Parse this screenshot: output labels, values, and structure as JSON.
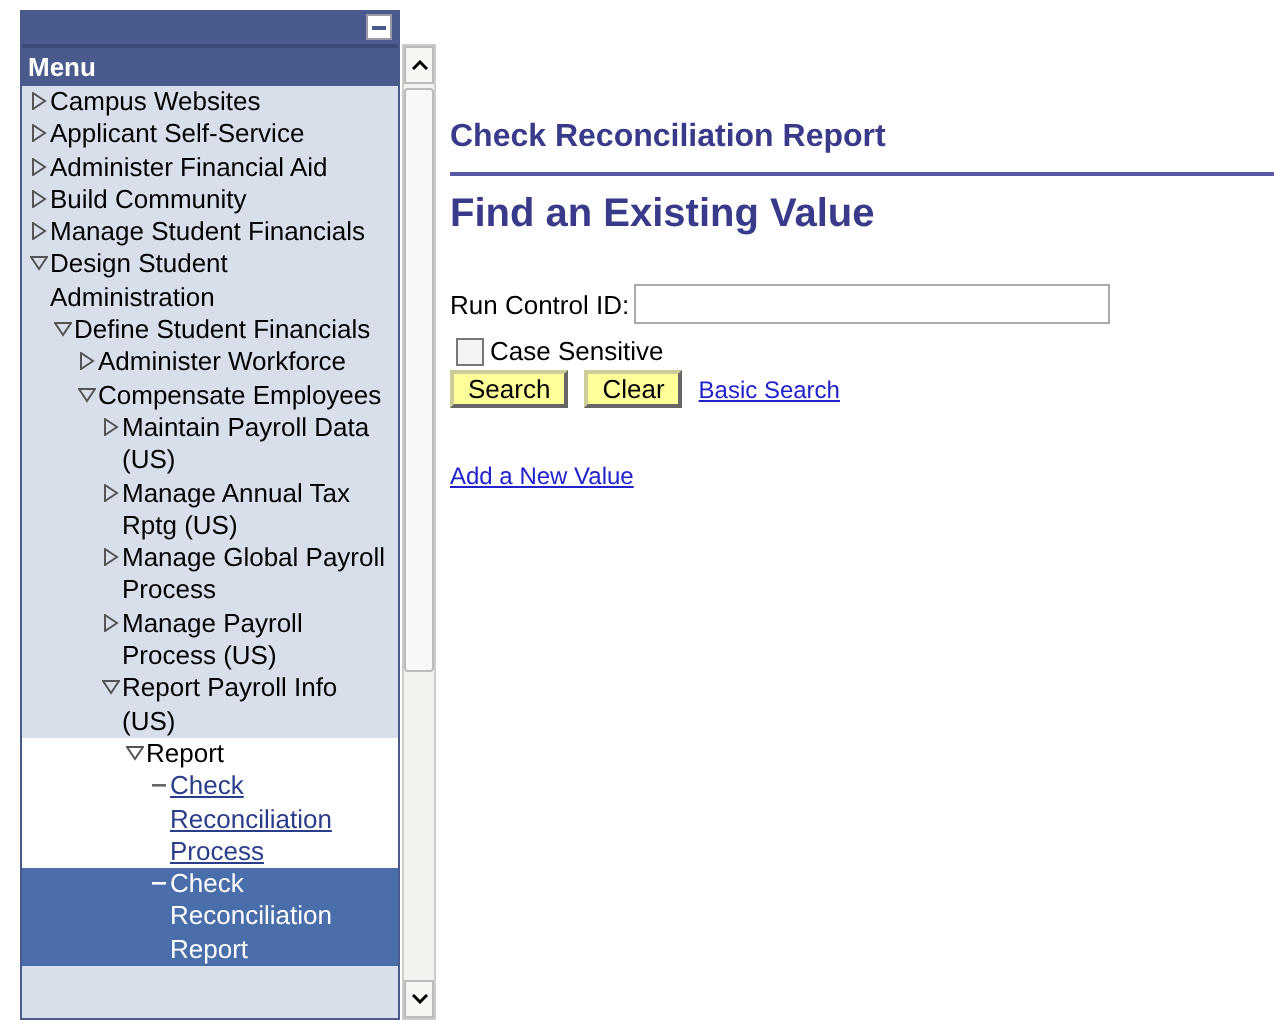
{
  "menu": {
    "title": "Menu",
    "items": [
      {
        "label": "Campus Websites",
        "kind": "folder",
        "expanded": false
      },
      {
        "label": "Applicant Self-Service",
        "kind": "folder",
        "expanded": false
      },
      {
        "label": "Administer Financial Aid",
        "kind": "folder",
        "expanded": false
      },
      {
        "label": "Build Community",
        "kind": "folder",
        "expanded": false
      },
      {
        "label": "Manage Student Financials",
        "kind": "folder",
        "expanded": false
      },
      {
        "label": "Design Student Administration",
        "kind": "folder",
        "expanded": true,
        "children": [
          {
            "label": "Define Student Financials",
            "kind": "folder",
            "expanded": true,
            "children": [
              {
                "label": "Administer Workforce",
                "kind": "folder",
                "expanded": false
              },
              {
                "label": "Compensate Employees",
                "kind": "folder",
                "expanded": true,
                "children": [
                  {
                    "label": "Maintain Payroll Data (US)",
                    "kind": "folder",
                    "expanded": false
                  },
                  {
                    "label": "Manage Annual Tax Rptg (US)",
                    "kind": "folder",
                    "expanded": false
                  },
                  {
                    "label": "Manage Global Payroll Process",
                    "kind": "folder",
                    "expanded": false
                  },
                  {
                    "label": "Manage Payroll Process (US)",
                    "kind": "folder",
                    "expanded": false
                  },
                  {
                    "label": "Report Payroll Info (US)",
                    "kind": "folder",
                    "expanded": true,
                    "children": [
                      {
                        "label": "Report",
                        "kind": "folder",
                        "expanded": true,
                        "current": true,
                        "children": [
                          {
                            "label": "Check Reconciliation Process",
                            "kind": "link",
                            "selected": false
                          },
                          {
                            "label": "Check Reconciliation Report",
                            "kind": "link",
                            "selected": true
                          }
                        ]
                      }
                    ]
                  }
                ]
              }
            ]
          }
        ]
      }
    ]
  },
  "page": {
    "title": "Check Reconciliation Report",
    "heading": "Find an Existing Value",
    "run_control": {
      "label": "Run Control ID:"
    },
    "case_sensitive": {
      "label": "Case Sensitive",
      "checked": false
    },
    "buttons": [
      "Search",
      "Clear"
    ],
    "basic_search": "Basic Search",
    "add_new": "Add a New Value"
  }
}
